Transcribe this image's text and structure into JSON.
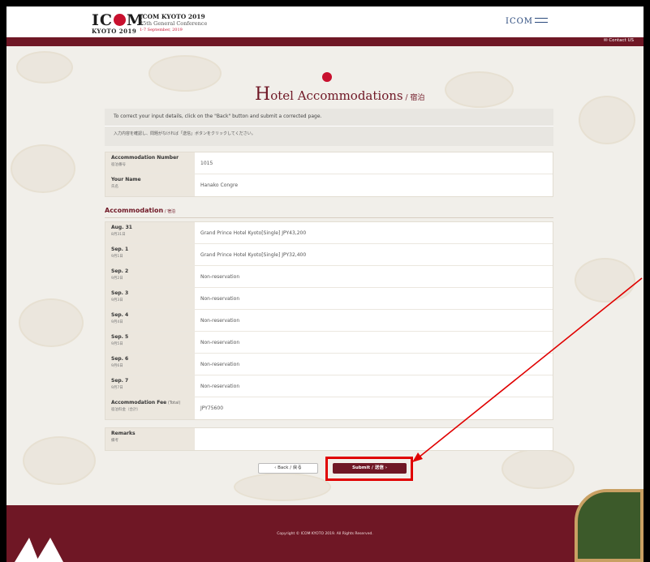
{
  "header": {
    "logo_line1_pre": "IC",
    "logo_line1_post": "M",
    "logo_line2": "KYOTO 2019",
    "conf_title": "ICOM KYOTO 2019",
    "conf_sub": "25th General Conference",
    "conf_dates": "1-7 September, 2019",
    "right_logo": "ICOM",
    "contact": "✉ Contact US"
  },
  "page": {
    "title_cap": "H",
    "title_rest": "otel Accommodations",
    "title_jp": " / 宿泊"
  },
  "notice": {
    "line_en": "To correct your input details, click on the \"Back\" button and submit a corrected page.",
    "line_ja": "入力内容を確認し、問題がなければ「送信」ボタンをクリックしてください。"
  },
  "info_rows": [
    {
      "en": "Accommodation Number",
      "ja": "宿泊番号",
      "value": "1015"
    },
    {
      "en": "Your Name",
      "ja": "氏名",
      "value": "Hanako Congre"
    }
  ],
  "section": {
    "title": "Accommodation",
    "jp": " / 宿泊"
  },
  "accommodation_rows": [
    {
      "en": "Aug. 31",
      "ja": "8月31日",
      "value": "Grand Prince Hotel Kyoto[Single] JPY43,200"
    },
    {
      "en": "Sep. 1",
      "ja": "9月1日",
      "value": "Grand Prince Hotel Kyoto[Single] JPY32,400"
    },
    {
      "en": "Sep. 2",
      "ja": "9月2日",
      "value": "Non-reservation"
    },
    {
      "en": "Sep. 3",
      "ja": "9月3日",
      "value": "Non-reservation"
    },
    {
      "en": "Sep. 4",
      "ja": "9月4日",
      "value": "Non-reservation"
    },
    {
      "en": "Sep. 5",
      "ja": "9月5日",
      "value": "Non-reservation"
    },
    {
      "en": "Sep. 6",
      "ja": "9月6日",
      "value": "Non-reservation"
    },
    {
      "en": "Sep. 7",
      "ja": "9月7日",
      "value": "Non-reservation"
    }
  ],
  "fee": {
    "en": "Accommodation Fee",
    "en_total": " (Total)",
    "ja": "宿泊料金（合計）",
    "value": "JPY75600"
  },
  "remarks": {
    "en": "Remarks",
    "ja": "備考",
    "value": ""
  },
  "buttons": {
    "back": "‹  Back / 戻る",
    "submit": "Submit / 送信  ›"
  },
  "footer": {
    "copyright": "Copyright © ICOM KYOTO 2019. All Rights Reserved."
  },
  "colors": {
    "brand": "#6f1725",
    "accent": "#c8102e",
    "highlight": "#e00000"
  }
}
